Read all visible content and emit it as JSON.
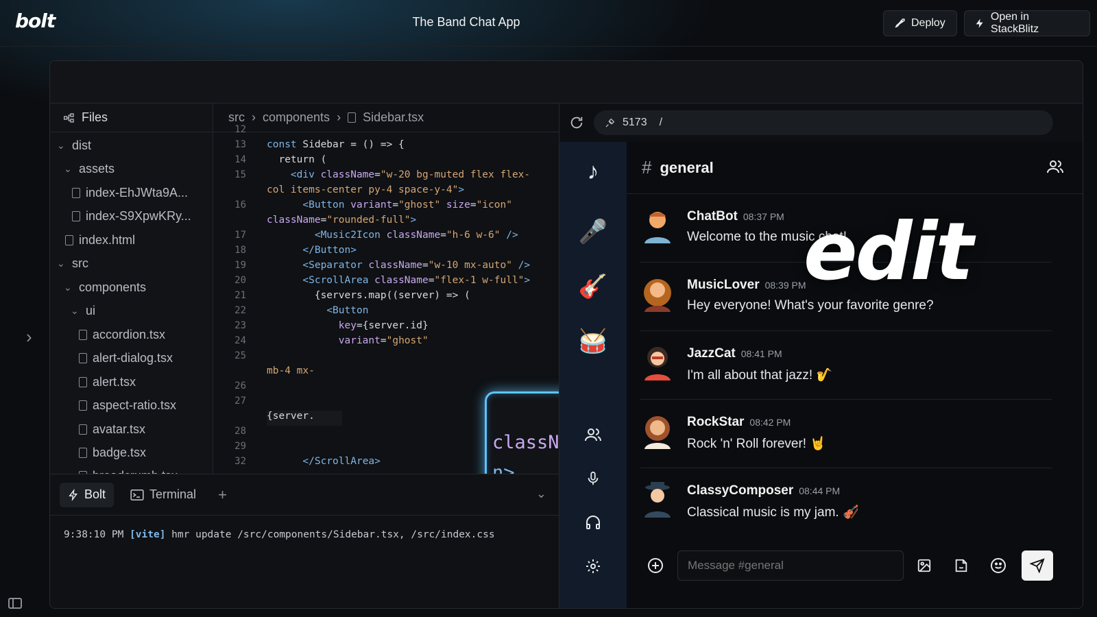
{
  "header": {
    "logo": "bolt",
    "title": "The Band Chat App",
    "deploy_label": "Deploy",
    "stackblitz_label": "Open in StackBlitz"
  },
  "filetree": {
    "title": "Files",
    "items": [
      {
        "label": "dist",
        "kind": "folder"
      },
      {
        "label": "assets",
        "kind": "folder"
      },
      {
        "label": "index-EhJWta9A...",
        "kind": "file"
      },
      {
        "label": "index-S9XpwKRy...",
        "kind": "file"
      },
      {
        "label": "index.html",
        "kind": "file"
      },
      {
        "label": "src",
        "kind": "folder"
      },
      {
        "label": "components",
        "kind": "folder"
      },
      {
        "label": "ui",
        "kind": "folder"
      },
      {
        "label": "accordion.tsx",
        "kind": "file"
      },
      {
        "label": "alert-dialog.tsx",
        "kind": "file"
      },
      {
        "label": "alert.tsx",
        "kind": "file"
      },
      {
        "label": "aspect-ratio.tsx",
        "kind": "file"
      },
      {
        "label": "avatar.tsx",
        "kind": "file"
      },
      {
        "label": "badge.tsx",
        "kind": "file"
      },
      {
        "label": "breadcrumb.tsx",
        "kind": "file"
      }
    ]
  },
  "editor": {
    "breadcrumb": [
      "src",
      "components",
      "Sidebar.tsx"
    ],
    "line_numbers": [
      "12",
      "13",
      "14",
      "15",
      "",
      "16",
      "",
      "17",
      "18",
      "19",
      "20",
      "21",
      "22",
      "23",
      "24",
      "25",
      "",
      "26",
      "27",
      "",
      "28",
      "29",
      "32"
    ],
    "zoom_line_1": "className=\"text-xl\">",
    "zoom_line_2": "n>",
    "partial_mb": "mb-4 mx-",
    "partial_server": "{server."
  },
  "bottom": {
    "tab_bolt": "Bolt",
    "tab_terminal": "Terminal",
    "term_time": "9:38:10 PM",
    "term_tag": "[vite]",
    "term_msg": "hmr update /src/components/Sidebar.tsx, /src/index.css"
  },
  "preview": {
    "port": "5173",
    "path": "/",
    "channel": "general",
    "composer_placeholder": "Message #general",
    "messages": [
      {
        "name": "ChatBot",
        "time": "08:37 PM",
        "text": "Welcome to the music chat!"
      },
      {
        "name": "MusicLover",
        "time": "08:39 PM",
        "text": "Hey everyone! What's your favorite genre?"
      },
      {
        "name": "JazzCat",
        "time": "08:41 PM",
        "text": "I'm all about that jazz! 🎷"
      },
      {
        "name": "RockStar",
        "time": "08:42 PM",
        "text": "Rock 'n' Roll forever! 🤘"
      },
      {
        "name": "ClassyComposer",
        "time": "08:44 PM",
        "text": "Classical music is my jam. 🎻"
      }
    ]
  },
  "overlay": {
    "label": "edit"
  },
  "colors": {
    "accent": "#5cc4ff",
    "rail": "#111b2a",
    "background": "#0b0d10"
  },
  "icons": [
    "rocket-icon",
    "bolt-icon",
    "refresh-icon",
    "plug-icon",
    "music-note-icon",
    "microphone-icon",
    "guitar-icon",
    "drum-icon",
    "users-icon",
    "mic-icon",
    "headphones-icon",
    "settings-icon",
    "plus-circle-icon",
    "image-icon",
    "sticker-icon",
    "smile-icon",
    "send-icon"
  ]
}
